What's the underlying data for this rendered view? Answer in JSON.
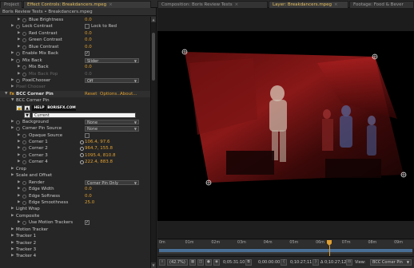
{
  "tabs": [
    {
      "label": "Project",
      "close": "×"
    },
    {
      "label": "Effect Controls: Breakdancers.mpeg",
      "close": "×"
    },
    {
      "label": "Composition: Boris Review Tests",
      "close": "×"
    },
    {
      "label": "Layer: Breakdancers.mpeg",
      "close": "×"
    },
    {
      "label": "Footage: Food & Bever",
      "close": ""
    }
  ],
  "left": {
    "breadcrumb": "Boris Review Tests • Breakdancers.mpeg",
    "rows": [
      {
        "label": "Blue Brightness",
        "value": "0.0",
        "kind": "value",
        "indent": 2
      },
      {
        "label": "Lock Contrast",
        "check": true,
        "checkLabel": "Lock to Red",
        "kind": "check",
        "indent": 1
      },
      {
        "label": "Red Contrast",
        "value": "0.0",
        "kind": "value",
        "indent": 2
      },
      {
        "label": "Green Contrast",
        "value": "0.0",
        "kind": "value",
        "indent": 2
      },
      {
        "label": "Blue Contrast",
        "value": "0.0",
        "kind": "value",
        "indent": 2
      },
      {
        "label": "Enable Mix Back",
        "check": "✓",
        "kind": "check",
        "indent": 1
      },
      {
        "label": "Mix Back",
        "dropdown": "Slider",
        "kind": "dropdown",
        "indent": 1
      },
      {
        "label": "Mix Back",
        "value": "0.0",
        "kind": "value",
        "indent": 2
      },
      {
        "label": "Mix Back Pop",
        "value": "0.0",
        "kind": "value",
        "indent": 2,
        "dim": true
      },
      {
        "label": "PixelChooser",
        "dropdown": "Off",
        "kind": "dropdown",
        "indent": 1
      },
      {
        "label": "Pixel Chooser",
        "kind": "label",
        "indent": 1,
        "dim": true
      },
      {
        "label": "BCC Corner Pin",
        "kind": "fx",
        "indent": 0,
        "reset": "Reset",
        "options": "Options...",
        "about": "About..."
      },
      {
        "label": "BCC Corner Pin",
        "kind": "section",
        "indent": 1
      },
      {
        "kind": "bfx"
      },
      {
        "label": "Background",
        "dropdown": "None",
        "kind": "dropdown",
        "indent": 1
      },
      {
        "label": "Corner Pin Source",
        "dropdown": "None",
        "kind": "dropdown",
        "indent": 1
      },
      {
        "label": "Opaque Source",
        "kind": "check",
        "check": "",
        "indent": 2
      },
      {
        "label": "Corner 1",
        "value": "106.4, 97.6",
        "kind": "value",
        "indent": 2,
        "target": true
      },
      {
        "label": "Corner 2",
        "value": "964.7, 155.8",
        "kind": "value",
        "indent": 2,
        "target": true
      },
      {
        "label": "Corner 3",
        "value": "1095.4, 810.8",
        "kind": "value",
        "indent": 2,
        "target": true
      },
      {
        "label": "Corner 4",
        "value": "222.4, 883.8",
        "kind": "value",
        "indent": 2,
        "target": true
      },
      {
        "label": "Crop",
        "kind": "label",
        "indent": 1
      },
      {
        "label": "Scale and Offset",
        "kind": "label",
        "indent": 1
      },
      {
        "label": "Render",
        "dropdown": "Corner Pin Only",
        "kind": "dropdown",
        "indent": 2
      },
      {
        "label": "Edge Width",
        "value": "0.0",
        "kind": "value",
        "indent": 2
      },
      {
        "label": "Edge Softness",
        "value": "0.0",
        "kind": "value",
        "indent": 2
      },
      {
        "label": "Edge Smoothness",
        "value": "25.0",
        "kind": "value",
        "indent": 2
      },
      {
        "label": "Light Wrap",
        "kind": "label",
        "indent": 1
      },
      {
        "label": "Composite",
        "kind": "label",
        "indent": 1
      },
      {
        "label": "Use Motion Trackers",
        "check": "✓",
        "kind": "check",
        "indent": 2
      },
      {
        "label": "Motion Tracker",
        "kind": "label",
        "indent": 1
      },
      {
        "label": "Tracker 1",
        "kind": "label",
        "indent": 1
      },
      {
        "label": "Tracker 2",
        "kind": "label",
        "indent": 1
      },
      {
        "label": "Tracker 3",
        "kind": "label",
        "indent": 1
      },
      {
        "label": "Tracker 4",
        "kind": "label",
        "indent": 1
      }
    ],
    "bfx": {
      "help": "HELP",
      "logo": "BORISFX.COM",
      "preset": "Current",
      "btn_lock": "🔒",
      "btn_save": "▲",
      "btn_load": "▼"
    }
  },
  "timeline": {
    "ticks": [
      "0m",
      "01m",
      "02m",
      "03m",
      "04m",
      "05m",
      "06m",
      "07m",
      "08m",
      "09m"
    ]
  },
  "bottom": {
    "zoom": "(42.7%)",
    "timecode": "0;05:31:10",
    "cur": "0;00:00:00",
    "in": "0;10:27;11",
    "dur": "Δ 0;10:27;12",
    "time2": "0;0",
    "zero": "0.0",
    "view_label": "View:",
    "view_value": "BCC Corner Pin"
  }
}
